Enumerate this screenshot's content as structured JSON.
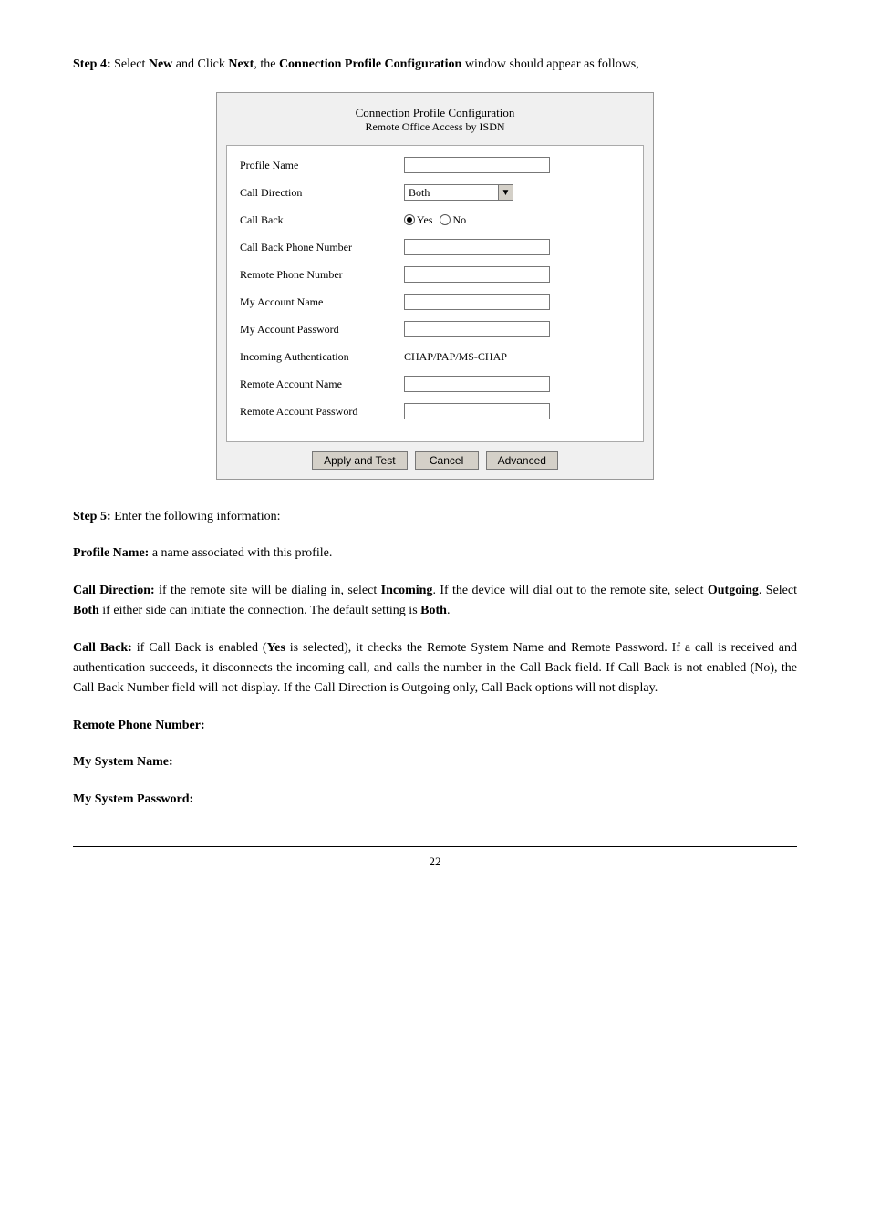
{
  "page": {
    "number": "22"
  },
  "step4": {
    "text_prefix": "Step 4:",
    "text_body": " Select ",
    "new_bold": "New",
    "text_and": " and Click ",
    "next_bold": "Next",
    "text_comma": ", the ",
    "config_bold": "Connection Profile Configuration",
    "text_end": " window should appear as follows,"
  },
  "dialog": {
    "title_main": "Connection Profile Configuration",
    "title_sub": "Remote Office Access by ISDN",
    "fields": [
      {
        "label": "Profile Name",
        "type": "input",
        "value": ""
      },
      {
        "label": "Call Direction",
        "type": "select",
        "value": "Both"
      },
      {
        "label": "Call Back",
        "type": "radio",
        "options": [
          "Yes",
          "No"
        ],
        "selected": "Yes"
      },
      {
        "label": "Call Back Phone Number",
        "type": "input",
        "value": ""
      },
      {
        "label": "Remote Phone Number",
        "type": "input",
        "value": ""
      },
      {
        "label": "My Account Name",
        "type": "input",
        "value": ""
      },
      {
        "label": "My Account Password",
        "type": "input",
        "value": ""
      },
      {
        "label": "Incoming Authentication",
        "type": "static",
        "value": "CHAP/PAP/MS-CHAP"
      },
      {
        "label": "Remote Account Name",
        "type": "input",
        "value": ""
      },
      {
        "label": "Remote Account Password",
        "type": "input",
        "value": ""
      }
    ],
    "buttons": [
      {
        "id": "apply-test",
        "label": "Apply and Test"
      },
      {
        "id": "cancel",
        "label": "Cancel"
      },
      {
        "id": "advanced",
        "label": "Advanced"
      }
    ]
  },
  "step5": {
    "text_prefix": "Step 5:",
    "text_body": " Enter the following information:"
  },
  "paragraphs": [
    {
      "id": "profile-name",
      "bold_prefix": "Profile Name:",
      "text": " a name associated with this profile."
    },
    {
      "id": "call-direction",
      "bold_prefix": "Call Direction:",
      "text": " if the remote site will be dialing in, select ",
      "bold1": "Incoming",
      "text2": ". If the device will dial out to the remote site, select ",
      "bold2": "Outgoing",
      "text3": ". Select ",
      "bold3": "Both",
      "text4": " if either side can initiate the connection. The default setting is ",
      "bold4": "Both",
      "text5": "."
    },
    {
      "id": "call-back",
      "bold_prefix": "Call Back:",
      "text": " if Call Back is enabled (",
      "bold1": "Yes",
      "text2": " is selected), it checks the Remote System Name and Remote Password. If a call is received and authentication succeeds, it disconnects the incoming call, and calls the number in the Call Back field. If Call Back is not enabled (No), the Call Back Number field will not display. If the Call Direction is Outgoing only, Call Back options will not display."
    },
    {
      "id": "remote-phone",
      "bold_prefix": "Remote Phone Number:",
      "text": ""
    },
    {
      "id": "my-system-name",
      "bold_prefix": "My System Name:",
      "text": ""
    },
    {
      "id": "my-system-password",
      "bold_prefix": "My System Password:",
      "text": ""
    }
  ]
}
